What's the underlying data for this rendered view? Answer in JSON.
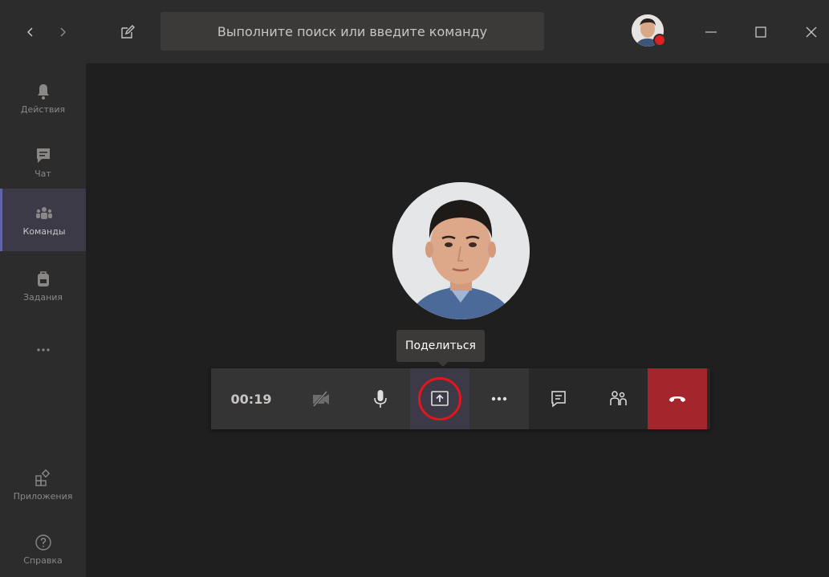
{
  "app": {
    "search_placeholder": "Выполните поиск или введите команду"
  },
  "rail": {
    "items": [
      {
        "label": "Действия",
        "icon": "bell-icon"
      },
      {
        "label": "Чат",
        "icon": "chat-icon"
      },
      {
        "label": "Команды",
        "icon": "teams-icon"
      },
      {
        "label": "Задания",
        "icon": "assignments-icon"
      },
      {
        "label": "",
        "icon": "more-icon"
      },
      {
        "label": "Приложения",
        "icon": "apps-icon"
      },
      {
        "label": "Справка",
        "icon": "help-icon"
      }
    ],
    "active_index": 2
  },
  "call": {
    "tooltip": "Поделиться",
    "timer": "00:19",
    "controls": [
      "camera-off-icon",
      "microphone-icon",
      "share-screen-icon",
      "more-options-icon",
      "chat-icon",
      "participants-icon",
      "hang-up-icon"
    ]
  },
  "colors": {
    "accent": "#6264a7",
    "hangup": "#a4262c",
    "highlight_ring": "#e4151c",
    "presence_busy": "#e02020"
  }
}
